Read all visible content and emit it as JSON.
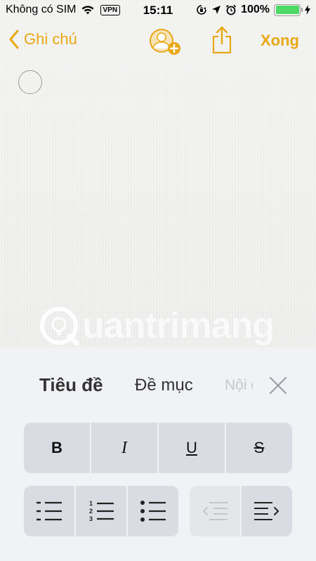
{
  "status_bar": {
    "carrier": "Không có SIM",
    "vpn": "VPN",
    "time": "15:11",
    "battery_percent": "100%",
    "battery_level": 1.0,
    "icons": [
      "wifi-icon",
      "vpn-badge",
      "screen-rotation-lock-icon",
      "location-icon",
      "alarm-icon",
      "battery-icon",
      "charging-icon"
    ]
  },
  "nav": {
    "back_label": "Ghi chú",
    "done_label": "Xong",
    "accent_color": "#e8a815",
    "icons": [
      "chevron-left-icon",
      "add-person-icon",
      "share-icon"
    ]
  },
  "watermark": {
    "text": "uantrimang"
  },
  "format_panel": {
    "styles": {
      "title": "Tiêu đề",
      "heading": "Đề mục",
      "body": "Nội dung"
    },
    "text_buttons": {
      "bold": "B",
      "italic": "I",
      "underline": "U",
      "strikethrough": "S"
    },
    "list_icons": [
      "dashed-list-icon",
      "numbered-list-icon",
      "bulleted-list-icon"
    ],
    "numbered_digits": [
      "1",
      "2",
      "3"
    ],
    "indent_icons": [
      "decrease-indent-icon",
      "increase-indent-icon"
    ]
  }
}
